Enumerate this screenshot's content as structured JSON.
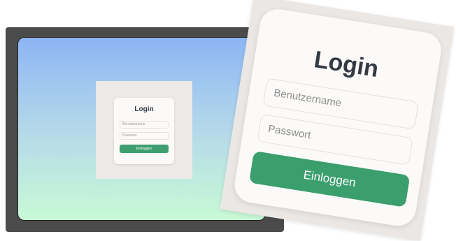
{
  "login": {
    "title": "Login",
    "username_placeholder": "Benutzername",
    "password_placeholder": "Passwort",
    "submit_label": "Einloggen"
  },
  "colors": {
    "gradient_top": "#8cb5f4",
    "gradient_bottom": "#c8fad6",
    "button": "#3d9e6e",
    "device_frame": "#4b4b4b",
    "card": "#fbfaf8"
  }
}
